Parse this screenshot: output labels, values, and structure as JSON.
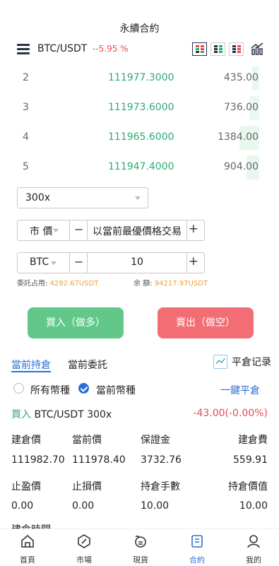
{
  "header": {
    "title": "永續合約",
    "pair": "BTC/USDT",
    "change": "--5.95 %"
  },
  "orderbook": [
    {
      "idx": "2",
      "price": "111977.3000",
      "amount": "435.00"
    },
    {
      "idx": "3",
      "price": "111973.6000",
      "amount": "736.00"
    },
    {
      "idx": "4",
      "price": "111965.6000",
      "amount": "1384.00"
    },
    {
      "idx": "5",
      "price": "111947.4000",
      "amount": "904.00"
    }
  ],
  "form": {
    "leverage": "300x",
    "order_type": "市 價",
    "price_text": "以當前最優價格交易",
    "unit": "BTC",
    "quantity": "10",
    "minus": "−",
    "plus": "+",
    "margin_label": "委託占用:",
    "margin_value": "4292.67USDT",
    "balance_label": "余 額:",
    "balance_value": "94217.97USDT"
  },
  "actions": {
    "buy": "買入（做多）",
    "sell": "賣出（做空）"
  },
  "tabs": {
    "positions": "當前持倉",
    "orders": "當前委託",
    "history": "平倉记录"
  },
  "filter": {
    "all": "所有幣種",
    "current": "當前幣種",
    "close_all": "一鍵平倉"
  },
  "position": {
    "side": "買入",
    "pair_lev": "BTC/USDT 300x",
    "pnl": "-43.00(-0.00%)",
    "labels1": [
      "建倉價",
      "當前價",
      "保證金",
      "建倉費"
    ],
    "values1": [
      "111982.70",
      "111978.40",
      "3732.76",
      "559.91"
    ],
    "labels2": [
      "止盈價",
      "止損價",
      "持倉手數",
      "持倉價值"
    ],
    "values2": [
      "0.00",
      "0.00",
      "10.00",
      "10.00"
    ],
    "partial": "建倉時間"
  },
  "nav": [
    "首頁",
    "市場",
    "現貨",
    "合約",
    "我的"
  ]
}
